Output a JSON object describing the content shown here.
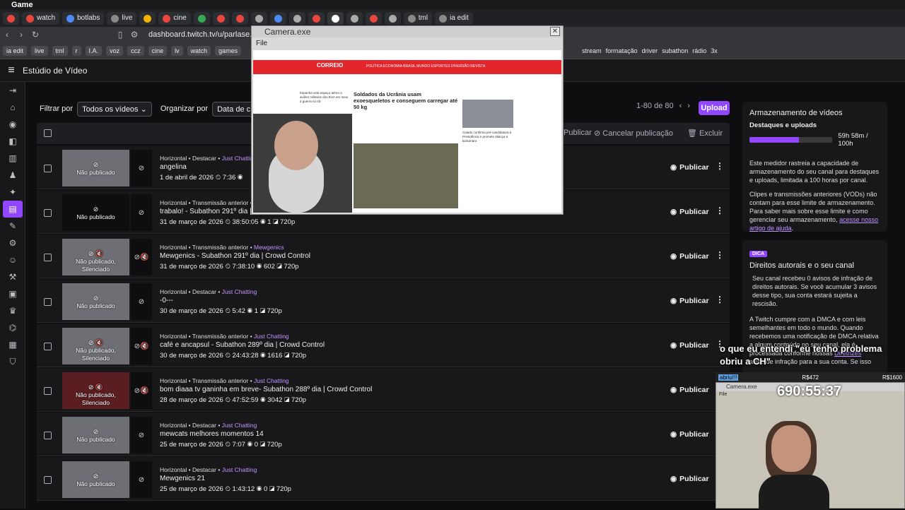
{
  "window": {
    "title": "Game"
  },
  "tabs": [
    {
      "label": "",
      "color": "#e8453c"
    },
    {
      "label": "watch",
      "color": "#e8453c"
    },
    {
      "label": "botlabs",
      "color": "#4c8bf5"
    },
    {
      "label": "live",
      "color": "#888"
    },
    {
      "label": "",
      "color": "#f4b400"
    },
    {
      "label": "cine",
      "color": "#e8453c"
    },
    {
      "label": "",
      "color": "#34a853"
    },
    {
      "label": "",
      "color": "#e8453c"
    },
    {
      "label": "",
      "color": "#e8453c"
    },
    {
      "label": "",
      "color": "#aaa"
    },
    {
      "label": "",
      "color": "#4c8bf5"
    },
    {
      "label": "",
      "color": "#aaa"
    },
    {
      "label": "",
      "color": "#e8453c"
    },
    {
      "label": "",
      "color": "#fff"
    },
    {
      "label": "",
      "color": "#aaa"
    },
    {
      "label": "",
      "color": "#e8453c"
    },
    {
      "label": "",
      "color": "#aaa"
    },
    {
      "label": "tml",
      "color": "#888"
    },
    {
      "label": "ia edit",
      "color": "#888"
    }
  ],
  "address": {
    "url": "dashboard.twitch.tv/u/parlase..."
  },
  "bookmarks": [
    "ia edit",
    "live",
    "tml",
    "r",
    "I.A.",
    "voz",
    "ccz",
    "cine",
    "lv",
    "watch",
    "games"
  ],
  "bookmarks_right": [
    "stream",
    "formatação",
    "driver",
    "subathon",
    "rádio",
    "3x"
  ],
  "header": {
    "title": "Estúdio de Vídeo"
  },
  "filters": {
    "filter_label": "Filtrar por",
    "filter_value": "Todos os vídeos",
    "sort_label": "Organizar por",
    "sort_value": "Data de criação"
  },
  "pager": {
    "range": "1-80 de 80"
  },
  "upload_label": "Upload",
  "bulk": {
    "publish": "Publicar",
    "cancel": "Cancelar publicação",
    "delete": "Excluir"
  },
  "rows": [
    {
      "thumb": "Não publicado",
      "type": "Horizontal • Destacar •",
      "category": "Just Chatting",
      "title": "angelina",
      "date": "1 de abril de 2026",
      "duration": "7:36",
      "views": "",
      "res": "",
      "publish": "Publicar",
      "style": "light"
    },
    {
      "thumb": "Não publicado",
      "type": "Horizontal • Transmissão anterior •",
      "category": "",
      "title": "trabalo! - Subathon 291º dia | C",
      "date": "31 de março de 2026",
      "duration": "38:50:05",
      "views": "1",
      "res": "720p",
      "publish": "Publicar",
      "style": "dark"
    },
    {
      "thumb": "Não publicado, Silenciado",
      "type": "Horizontal • Transmissão anterior •",
      "category": "Mewgenics",
      "title": "Mewgenics - Subathon 291º dia | Crowd Control",
      "date": "31 de março de 2026",
      "duration": "7:38:10",
      "views": "602",
      "res": "720p",
      "publish": "Publicar",
      "style": "light"
    },
    {
      "thumb": "Não publicado",
      "type": "Horizontal • Destacar •",
      "category": "Just Chatting",
      "title": "-0---",
      "date": "30 de março de 2026",
      "duration": "5:42",
      "views": "1",
      "res": "720p",
      "publish": "Publicar",
      "style": "light"
    },
    {
      "thumb": "Não publicado, Silenciado",
      "type": "Horizontal • Transmissão anterior •",
      "category": "Just Chatting",
      "title": "café e ancapsul - Subathon 289º dia | Crowd Control",
      "date": "30 de março de 2026",
      "duration": "24:43:28",
      "views": "1616",
      "res": "720p",
      "publish": "Publicar",
      "style": "light"
    },
    {
      "thumb": "Não publicado, Silenciado",
      "type": "Horizontal • Transmissão anterior •",
      "category": "Just Chatting",
      "title": "bom diaaa tv ganinha em breve- Subathon 288º dia | Crowd Control",
      "date": "28 de março de 2026",
      "duration": "47:52:59",
      "views": "3042",
      "res": "720p",
      "publish": "Publicar",
      "style": "red"
    },
    {
      "thumb": "Não publicado",
      "type": "Horizontal • Destacar •",
      "category": "Just Chatting",
      "title": "mewcats melhores momentos 14",
      "date": "25 de março de 2026",
      "duration": "7:07",
      "views": "0",
      "res": "720p",
      "publish": "Publicar",
      "style": "light"
    },
    {
      "thumb": "Não publicado",
      "type": "Horizontal • Destacar •",
      "category": "Just Chatting",
      "title": "Mewgenics 21",
      "date": "25 de março de 2026",
      "duration": "1:43:12",
      "views": "0",
      "res": "720p",
      "publish": "Publicar",
      "style": "light"
    }
  ],
  "storage": {
    "title": "Armazenamento de vídeos",
    "subtitle": "Destaques e uploads",
    "usage": "59h 58m / 100h",
    "usage_fraction": 0.6,
    "p1": "Este medidor rastreia a capacidade de armazenamento do seu canal para destaques e uploads, limitada a 100 horas por canal.",
    "p2": "Clipes e transmissões anteriores (VODs) não contam para esse limite de armazenamento. Para saber mais sobre esse limite e como gerenciar seu armazenamento,",
    "p2_link": "acesse nosso artigo de ajuda"
  },
  "copyright": {
    "badge": "DICA",
    "title": "Direitos autorais e o seu canal",
    "p1": "Seu canal recebeu 0 avisos de infração de direitos autorais. Se você acumular 3 avisos desse tipo, sua conta estará sujeita a rescisão.",
    "p2": "A Twitch cumpre com a DMCA e com leis semelhantes em todo o mundo. Quando recebemos uma notificação de DMCA relativa a algum conteúdo no seu canal, ela é processada conforme nossas",
    "p2_link": "Diretrizes",
    "p3": "aviso de infração para a sua conta. Se isso"
  },
  "camera": {
    "title": "Camera.exe",
    "menu": "File",
    "news_logo": "CORREIO",
    "news_nav": "POLÍTICA  ECONOMIA  BRASIL  MUNDO  ESPORTES  DIVERSÃO  REVISTA",
    "news_headline": "Soldados da Ucrânia usam exoesqueletos e conseguem carregar até 50 kg",
    "news_side": "Caiado confirma pré-candidatura à Presidência e promete aliança a Bolsonaro",
    "news_left": "Espanha veta espaço aéreo a aviões militares dos EUA em meio à guerra no Irã"
  },
  "overlay": {
    "chat": "o que eu entendi \"eu tenho problema obriu a CH\"",
    "bar_left": "abriu!!!",
    "bar_mid": "R$472",
    "bar_right": "R$1600",
    "cam_title": "Camera.exe",
    "cam_menu": "File",
    "timer": "690:55:37"
  }
}
